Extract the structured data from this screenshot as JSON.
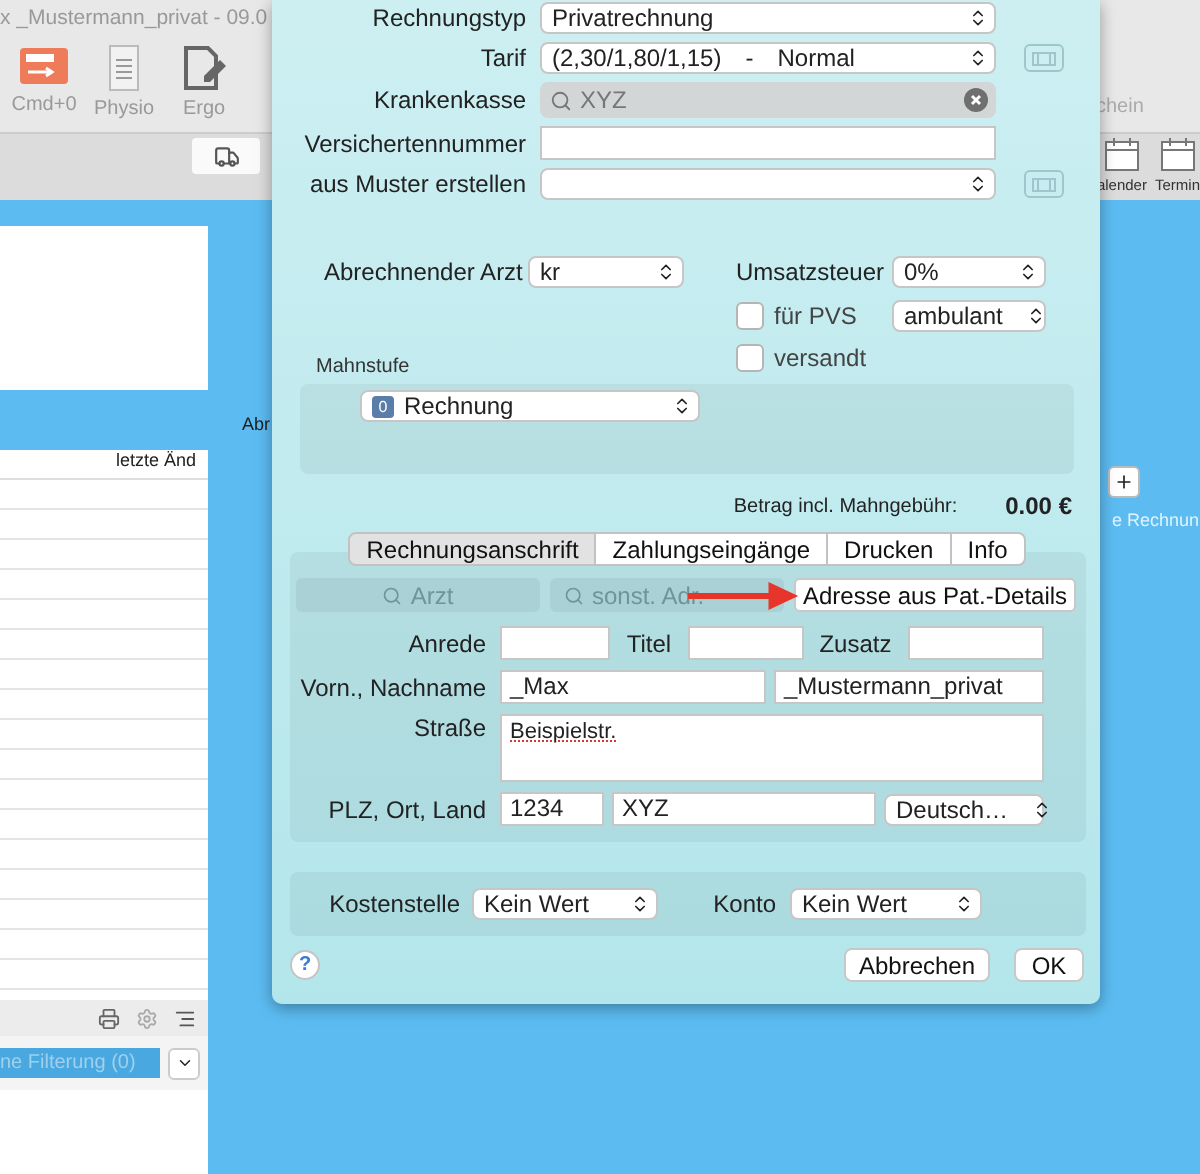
{
  "background_window": {
    "title": "x _Mustermann_privat - 09.0",
    "toolbar": [
      {
        "label": "Cmd+0",
        "kind": "invoice"
      },
      {
        "label": "Physio",
        "kind": "document"
      },
      {
        "label": "Ergo",
        "kind": "edit"
      }
    ],
    "toolbar_right_label": "chein",
    "subtoolbar": [
      {
        "label": "alender"
      },
      {
        "label": "Termin"
      }
    ],
    "table": {
      "columns": [
        "letzte Änd"
      ]
    },
    "section_label": "Abr",
    "side_label": "e Rechnun",
    "filter": "ne Filterung (0)"
  },
  "dialog": {
    "header_rows": [
      {
        "label": "Rechnungstyp",
        "kind": "popup",
        "value": [
          "Privatrechnung"
        ]
      },
      {
        "label": "Tarif",
        "kind": "popup",
        "value": [
          "(2,30/1,80/1,15)",
          "-",
          "Normal"
        ],
        "side_button": true
      },
      {
        "label": "Krankenkasse",
        "kind": "search",
        "value": [
          "XYZ"
        ]
      },
      {
        "label": "Versichertennummer",
        "kind": "text"
      },
      {
        "label": "aus Muster erstellen",
        "kind": "popup",
        "side_button": true
      }
    ],
    "doctor": {
      "label": "Abrechnender Arzt",
      "value": "kr"
    },
    "vat": {
      "label": "Umsatzsteuer",
      "value": "0%"
    },
    "checkboxes": [
      {
        "label": "für PVS",
        "checked": false
      },
      {
        "label": "versandt",
        "checked": false
      }
    ],
    "treatment": {
      "value": "ambulant"
    },
    "dunning": {
      "label": "Mahnstufe",
      "badge": "0",
      "value": "Rechnung"
    },
    "total": {
      "label": "Betrag incl. Mahngebühr:",
      "value": "0.00 €"
    },
    "tabs": [
      {
        "label": "Rechnungsanschrift",
        "selected": true
      },
      {
        "label": "Zahlungseingänge",
        "selected": false
      },
      {
        "label": "Drucken",
        "selected": false
      },
      {
        "label": "Info",
        "selected": false
      }
    ],
    "address_buttons": [
      {
        "label": "Arzt",
        "kind": "search",
        "disabled": true
      },
      {
        "label": "sonst. Adr.",
        "kind": "search",
        "disabled": true
      },
      {
        "label": "Adresse aus Pat.-Details",
        "kind": "plain",
        "disabled": false
      }
    ],
    "address": {
      "salutation": {
        "label": "Anrede"
      },
      "title": {
        "label": "Titel"
      },
      "suffix": {
        "label": "Zusatz"
      },
      "name": {
        "label": "Vorn., Nachname",
        "first": "_Max",
        "last": "_Mustermann_privat"
      },
      "street": {
        "label": "Straße",
        "value": "Beispielstr."
      },
      "city": {
        "label": "PLZ, Ort, Land",
        "zip": "1234",
        "city": "XYZ",
        "country": "Deutsch…"
      }
    },
    "cost": {
      "label": "Kostenstelle",
      "value": "Kein Wert"
    },
    "account": {
      "label": "Konto",
      "value": "Kein Wert"
    },
    "help": "?",
    "buttons": [
      "Abbrechen",
      "OK"
    ]
  }
}
